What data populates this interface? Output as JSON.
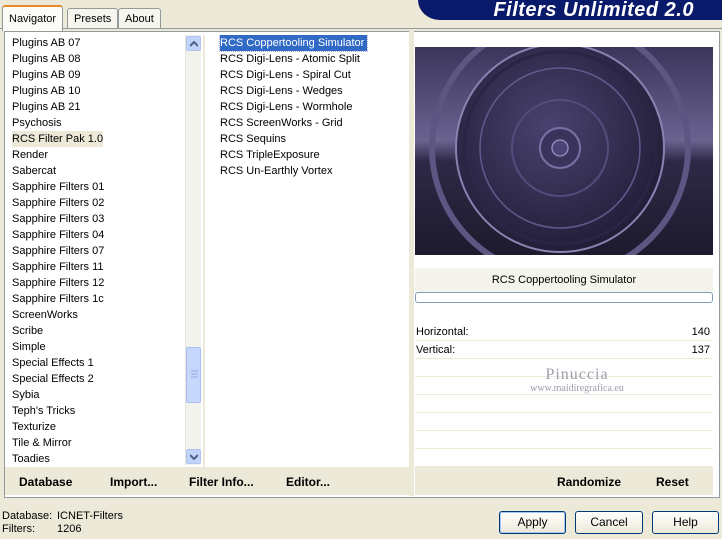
{
  "window": {
    "title": "Filters Unlimited 2.0"
  },
  "tabs": [
    {
      "label": "Navigator",
      "active": true
    },
    {
      "label": "Presets",
      "active": false
    },
    {
      "label": "About",
      "active": false
    }
  ],
  "categories": {
    "items": [
      "Plugins AB 07",
      "Plugins AB 08",
      "Plugins AB 09",
      "Plugins AB 10",
      "Plugins AB 21",
      "Psychosis",
      "RCS Filter Pak 1.0",
      "Render",
      "Sabercat",
      "Sapphire Filters 01",
      "Sapphire Filters 02",
      "Sapphire Filters 03",
      "Sapphire Filters 04",
      "Sapphire Filters 07",
      "Sapphire Filters 11",
      "Sapphire Filters 12",
      "Sapphire Filters 1c",
      "ScreenWorks",
      "Scribe",
      "Simple",
      "Special Effects 1",
      "Special Effects 2",
      "Sybia",
      "Teph's Tricks",
      "Texturize",
      "Tile & Mirror",
      "Toadies"
    ],
    "selected": "RCS Filter Pak 1.0"
  },
  "filters": {
    "items": [
      "RCS Coppertooling Simulator",
      "RCS Digi-Lens - Atomic Split",
      "RCS Digi-Lens - Spiral Cut",
      "RCS Digi-Lens - Wedges",
      "RCS Digi-Lens - Wormhole",
      "RCS ScreenWorks - Grid",
      "RCS Sequins",
      "RCS TripleExposure",
      "RCS Un-Earthly Vortex"
    ],
    "selected": "RCS Coppertooling Simulator"
  },
  "preview": {
    "filter_name": "RCS Coppertooling Simulator",
    "progress": 0
  },
  "params": [
    {
      "label": "Horizontal:",
      "value": "140"
    },
    {
      "label": "Vertical:",
      "value": "137"
    }
  ],
  "watermark": {
    "name": "Pinuccia",
    "url": "www.maidiregrafica.eu"
  },
  "toolbar": {
    "database": "Database",
    "import": "Import...",
    "filter_info": "Filter Info...",
    "editor": "Editor...",
    "randomize": "Randomize",
    "reset": "Reset"
  },
  "status": {
    "database_label": "Database:",
    "database_value": "ICNET-Filters",
    "filters_label": "Filters:",
    "filters_value": "1206"
  },
  "buttons": {
    "apply": "Apply",
    "cancel": "Cancel",
    "help": "Help"
  },
  "colors": {
    "banner": "#0a1a6a",
    "selection": "#316ac5",
    "face": "#ece9d8"
  },
  "icons": {
    "scroll_up": "chevron-up-icon",
    "scroll_down": "chevron-down-icon",
    "grip": "grip-icon"
  }
}
